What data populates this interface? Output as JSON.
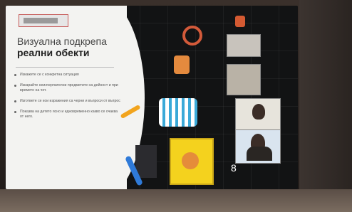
{
  "slide": {
    "title_line1": "Визуална подкрепа",
    "title_line2": "реални обекти",
    "bullets": [
      "Изкажете се с конкретна ситуация",
      "Изкарайте неизчерпателни предметите на дейност и при времето на чет.",
      "Изгответе се кои изражения са черни и въпроси от въпрос",
      "Показва на детето ясно и едновременно какво се очаква от него."
    ],
    "screen_number": "8"
  },
  "colors": {
    "slide_background": "#f3f3f1",
    "accent_red": "#c65a58",
    "dark_panel": "#121314"
  }
}
